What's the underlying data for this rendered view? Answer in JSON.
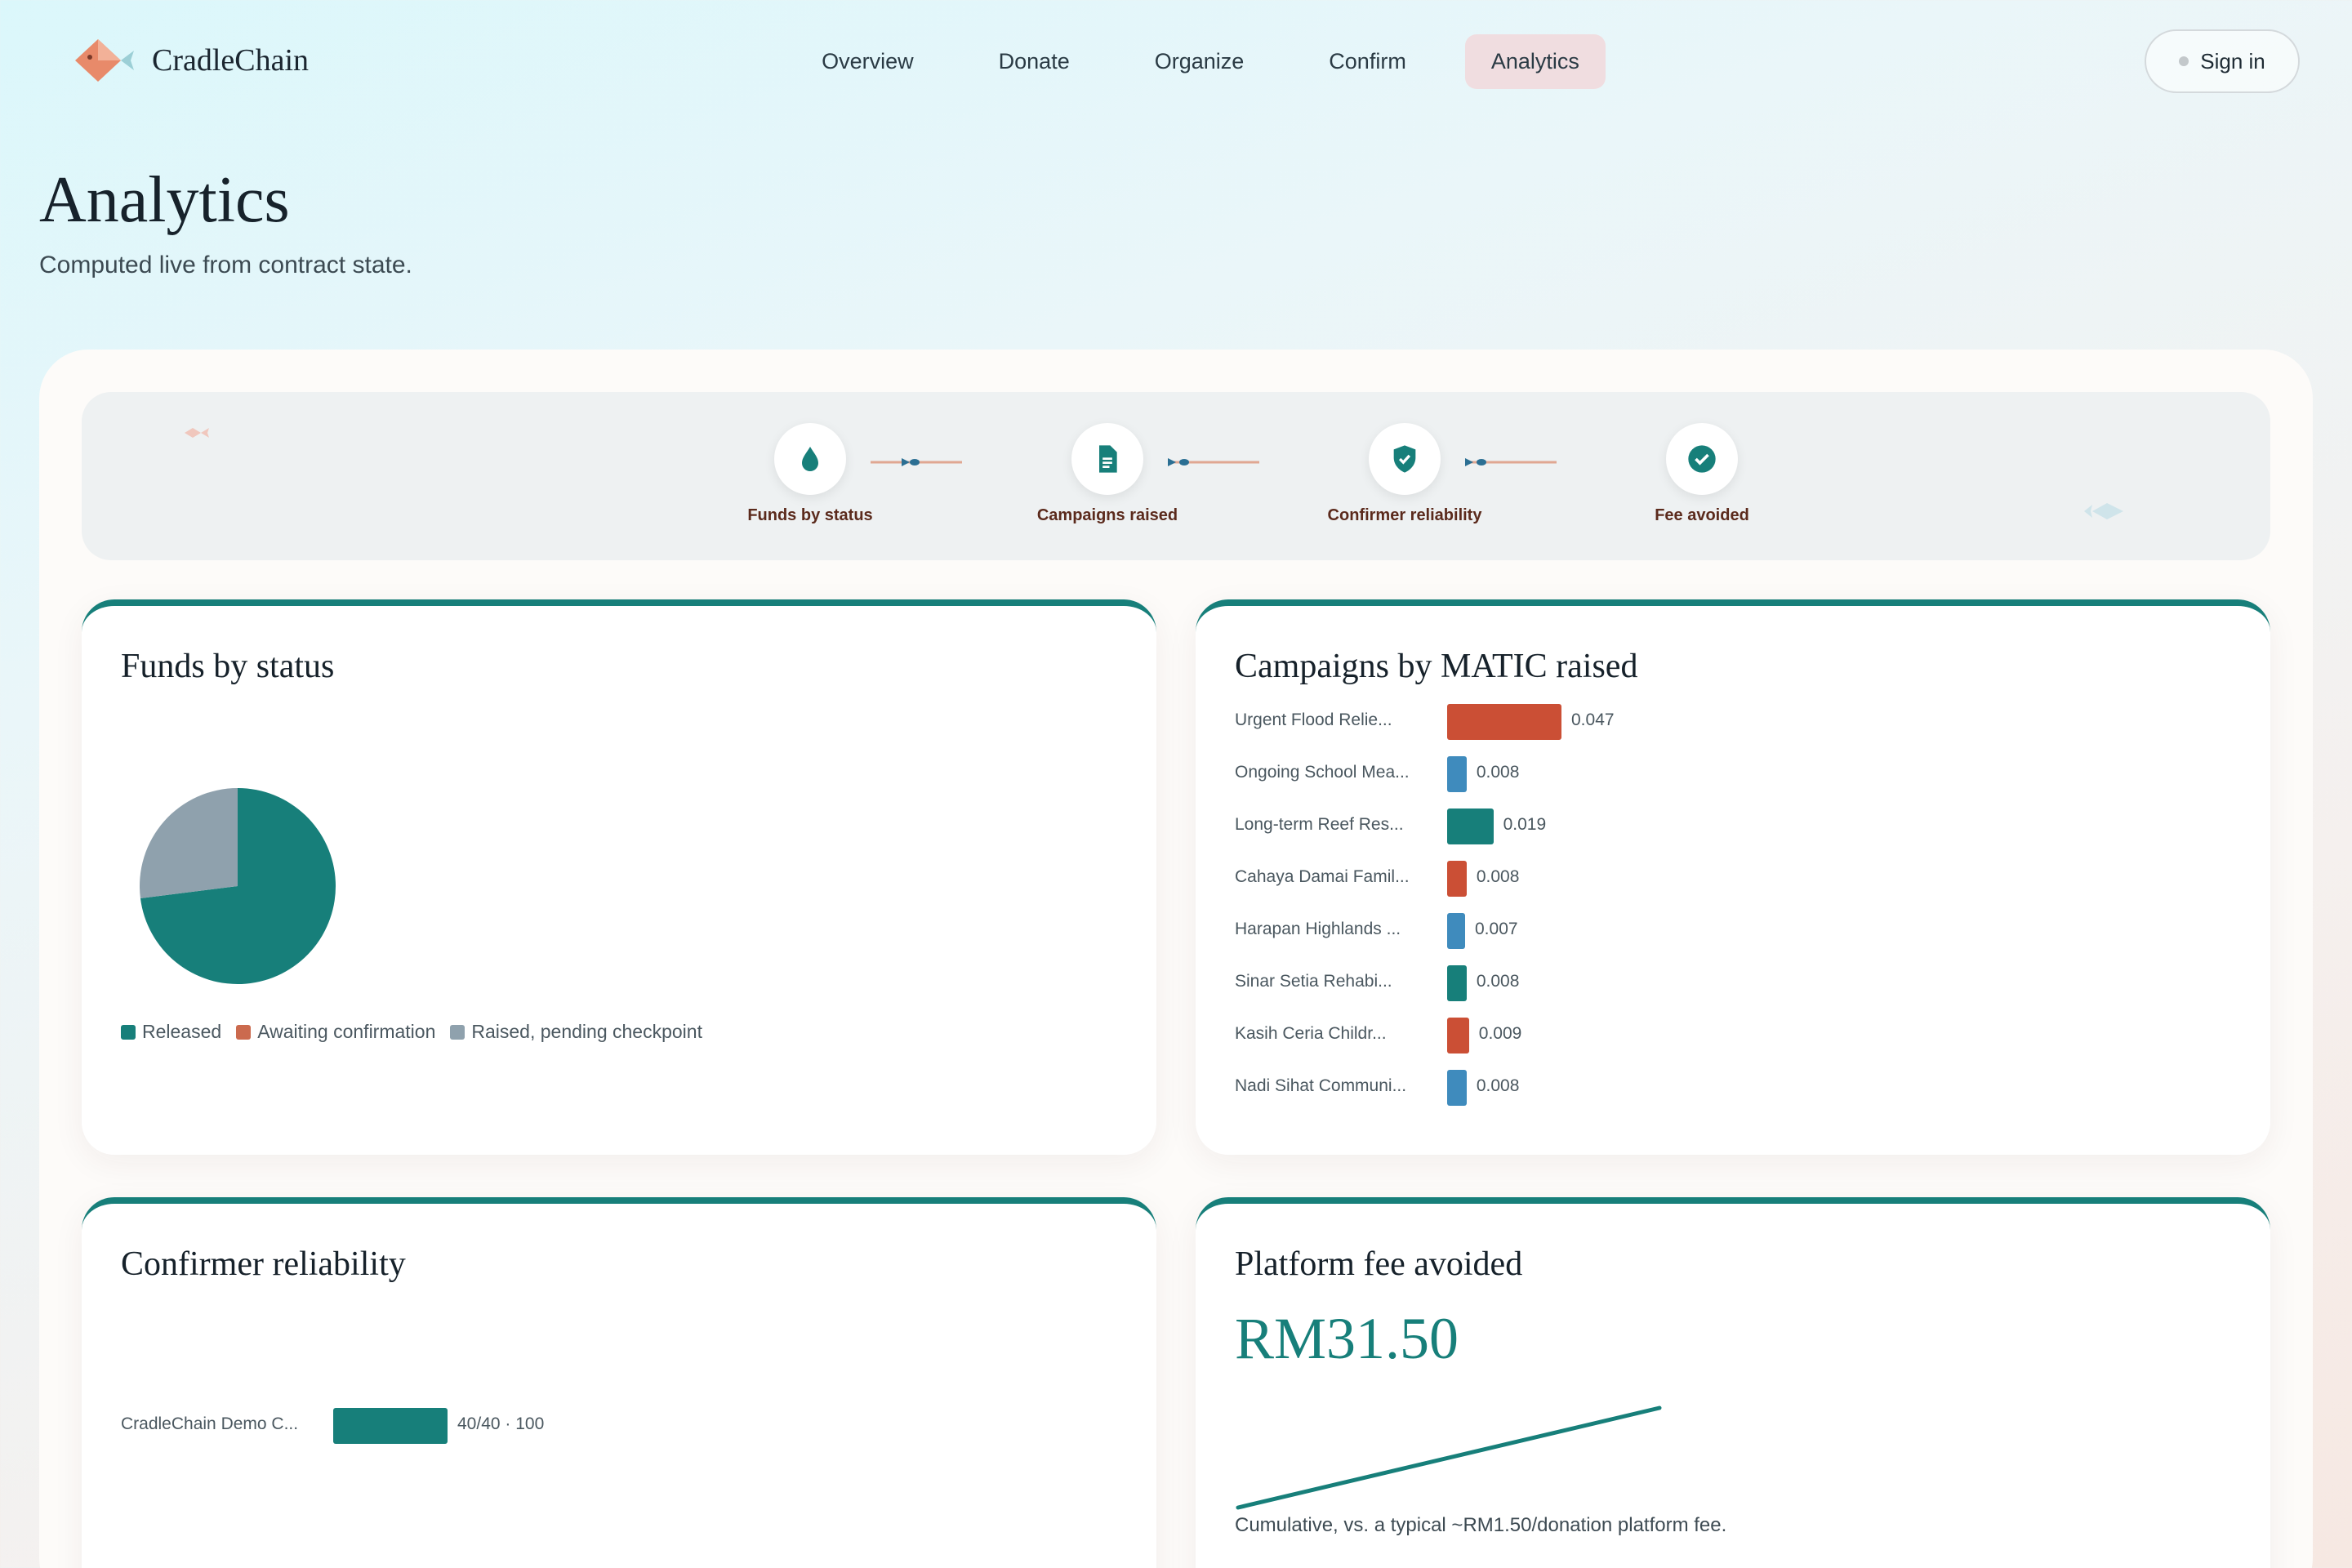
{
  "header": {
    "logo_text": "CradleChain",
    "nav": [
      {
        "label": "Overview",
        "active": false
      },
      {
        "label": "Donate",
        "active": false
      },
      {
        "label": "Organize",
        "active": false
      },
      {
        "label": "Confirm",
        "active": false
      },
      {
        "label": "Analytics",
        "active": true
      }
    ],
    "signin_label": "Sign in"
  },
  "page": {
    "title": "Analytics",
    "subtitle": "Computed live from contract state."
  },
  "stepper": {
    "steps": [
      {
        "label": "Funds by status",
        "icon": "drop-icon"
      },
      {
        "label": "Campaigns raised",
        "icon": "document-icon"
      },
      {
        "label": "Confirmer reliability",
        "icon": "shield-check-icon"
      },
      {
        "label": "Fee avoided",
        "icon": "check-circle-icon"
      }
    ]
  },
  "colors": {
    "teal": "#177f7a",
    "coral": "#cb4f35",
    "blue": "#3f8bbd",
    "gray": "#8fa1ad"
  },
  "funds_card": {
    "title": "Funds by status",
    "chart_data": {
      "type": "pie",
      "slices": [
        {
          "name": "Released",
          "value": 73,
          "color": "#177f7a"
        },
        {
          "name": "Awaiting confirmation",
          "value": 0,
          "color": "#cb6a4e"
        },
        {
          "name": "Raised, pending checkpoint",
          "value": 27,
          "color": "#8fa1ad"
        }
      ]
    }
  },
  "campaigns_card": {
    "title": "Campaigns by MATIC raised",
    "chart_data": {
      "type": "bar",
      "categories": [
        "Urgent Flood Relie...",
        "Ongoing School Mea...",
        "Long-term Reef Res...",
        "Cahaya Damai Famil...",
        "Harapan Highlands ...",
        "Sinar Setia Rehabi...",
        "Kasih Ceria Childr...",
        "Nadi Sihat Communi..."
      ],
      "values": [
        0.047,
        0.008,
        0.019,
        0.008,
        0.007,
        0.008,
        0.009,
        0.008
      ],
      "value_labels": [
        "0.047",
        "0.008",
        "0.019",
        "0.008",
        "0.007",
        "0.008",
        "0.009",
        "0.008"
      ],
      "colors": [
        "#cb4f35",
        "#3f8bbd",
        "#177f7a",
        "#cb4f35",
        "#3f8bbd",
        "#177f7a",
        "#cb4f35",
        "#3f8bbd"
      ]
    }
  },
  "confirmer_card": {
    "title": "Confirmer reliability",
    "chart_data": {
      "type": "bar",
      "categories": [
        "CradleChain Demo C..."
      ],
      "values": [
        100
      ],
      "value_labels": [
        "40/40 · 100"
      ],
      "xlim": [
        0,
        100
      ]
    }
  },
  "fee_card": {
    "title": "Platform fee avoided",
    "value": "RM31.50",
    "note": "Cumulative, vs. a typical ~RM1.50/donation platform fee.",
    "chart_data": {
      "type": "line",
      "values": [
        0,
        31.5
      ]
    }
  }
}
